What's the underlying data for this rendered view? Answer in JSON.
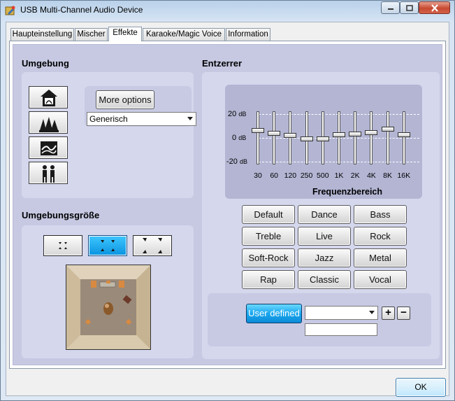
{
  "window": {
    "title": "USB Multi-Channel Audio Device",
    "ok_label": "OK"
  },
  "tabs": [
    {
      "label": "Haupteinstellung"
    },
    {
      "label": "Mischer"
    },
    {
      "label": "Effekte"
    },
    {
      "label": "Karaoke/Magic Voice"
    },
    {
      "label": "Information"
    }
  ],
  "environment": {
    "title": "Umgebung",
    "more_options_label": "More options",
    "preset_selected": "Generisch"
  },
  "environment_size": {
    "title": "Umgebungsgröße",
    "selected_index": 1
  },
  "equalizer": {
    "title": "Entzerrer",
    "db_labels": [
      {
        "value": "20",
        "unit": "dB"
      },
      {
        "value": "0",
        "unit": "dB"
      },
      {
        "value": "-20",
        "unit": "dB"
      }
    ],
    "bands": [
      {
        "freq": "30",
        "level": 0.28
      },
      {
        "freq": "60",
        "level": 0.18
      },
      {
        "freq": "120",
        "level": 0.1
      },
      {
        "freq": "250",
        "level": -0.03
      },
      {
        "freq": "500",
        "level": -0.03
      },
      {
        "freq": "1K",
        "level": 0.13
      },
      {
        "freq": "2K",
        "level": 0.15
      },
      {
        "freq": "4K",
        "level": 0.2
      },
      {
        "freq": "8K",
        "level": 0.33
      },
      {
        "freq": "16K",
        "level": 0.13
      }
    ],
    "axis_label": "Frequenzbereich",
    "presets": [
      "Default",
      "Dance",
      "Bass",
      "Treble",
      "Live",
      "Rock",
      "Soft-Rock",
      "Jazz",
      "Metal",
      "Rap",
      "Classic",
      "Vocal"
    ],
    "user_defined_label": "User defined",
    "user_preset_selected": "",
    "add_label": "+",
    "remove_label": "−"
  }
}
